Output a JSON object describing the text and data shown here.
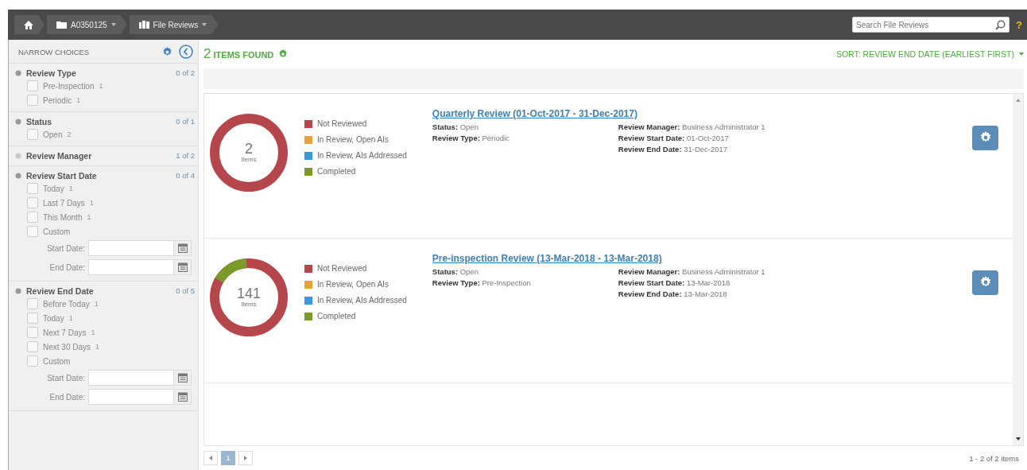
{
  "breadcrumbs": [
    {
      "kind": "home"
    },
    {
      "kind": "folder",
      "label": "A0350125"
    },
    {
      "kind": "reviews",
      "label": "File Reviews"
    }
  ],
  "search": {
    "placeholder": "Search File Reviews"
  },
  "help": "?",
  "sidebar": {
    "title": "NARROW CHOICES",
    "groups": [
      {
        "title": "Review Type",
        "count": "0 of 2",
        "expanded": true,
        "items": [
          {
            "label": "Pre-Inspection",
            "count": "1",
            "checked": false
          },
          {
            "label": "Periodic",
            "count": "1",
            "checked": false
          }
        ]
      },
      {
        "title": "Status",
        "count": "0 of 1",
        "expanded": true,
        "items": [
          {
            "label": "Open",
            "count": "2",
            "checked": false
          }
        ]
      },
      {
        "title": "Review Manager",
        "count": "1 of 2",
        "expanded": false
      },
      {
        "title": "Review Start Date",
        "count": "0 of 4",
        "expanded": true,
        "items": [
          {
            "label": "Today",
            "count": "1",
            "checked": false
          },
          {
            "label": "Last 7 Days",
            "count": "1",
            "checked": false
          },
          {
            "label": "This Month",
            "count": "1",
            "checked": false
          },
          {
            "label": "Custom",
            "checked": false
          }
        ],
        "date_fields": [
          {
            "label": "Start Date:"
          },
          {
            "label": "End Date:"
          }
        ]
      },
      {
        "title": "Review End Date",
        "count": "0 of 5",
        "expanded": true,
        "items": [
          {
            "label": "Before Today",
            "count": "1",
            "checked": false
          },
          {
            "label": "Today",
            "count": "1",
            "checked": false
          },
          {
            "label": "Next 7 Days",
            "count": "1",
            "checked": false
          },
          {
            "label": "Next 30 Days",
            "count": "1",
            "checked": false
          },
          {
            "label": "Custom",
            "checked": false
          }
        ],
        "date_fields": [
          {
            "label": "Start Date:"
          },
          {
            "label": "End Date:"
          }
        ]
      }
    ]
  },
  "results": {
    "count": "2",
    "label": "ITEMS FOUND",
    "sort": "SORT: REVIEW END DATE (EARLIEST FIRST)"
  },
  "records": [
    {
      "legend": [
        {
          "label": "Not Reviewed",
          "color": "#b5474c"
        },
        {
          "label": "In Review, Open AIs",
          "color": "#e8a03c"
        },
        {
          "label": "In Review, AIs Addressed",
          "color": "#3a9ad9"
        },
        {
          "label": "Completed",
          "color": "#7a9a2a"
        }
      ],
      "total": "2",
      "unit": "Items",
      "completed_segment": false,
      "title": "Quarterly Review (01-Oct-2017 - 31-Dec-2017)",
      "left": [
        {
          "label": "Status:",
          "value": "Open"
        },
        {
          "label": "Review Type:",
          "value": "Periodic"
        }
      ],
      "right": [
        {
          "label": "Review Manager:",
          "value": "Business Administrator 1"
        },
        {
          "label": "Review Start Date:",
          "value": "01-Oct-2017"
        },
        {
          "label": "Review End Date:",
          "value": "31-Dec-2017"
        }
      ]
    },
    {
      "legend": [
        {
          "label": "Not Reviewed",
          "color": "#b5474c"
        },
        {
          "label": "In Review, Open AIs",
          "color": "#e8a03c"
        },
        {
          "label": "In Review, AIs Addressed",
          "color": "#3a9ad9"
        },
        {
          "label": "Completed",
          "color": "#7a9a2a"
        }
      ],
      "total": "141",
      "unit": "Items",
      "completed_segment": true,
      "title": "Pre-inspection Review (13-Mar-2018 - 13-Mar-2018)",
      "left": [
        {
          "label": "Status:",
          "value": "Open"
        },
        {
          "label": "Review Type:",
          "value": "Pre-Inspection"
        }
      ],
      "right": [
        {
          "label": "Review Manager:",
          "value": "Business Administrator 1"
        },
        {
          "label": "Review Start Date:",
          "value": "13-Mar-2018"
        },
        {
          "label": "Review End Date:",
          "value": "13-Mar-2018"
        }
      ]
    }
  ],
  "pager": {
    "pages": [
      {
        "label": "1",
        "selected": true
      }
    ],
    "summary": "1 - 2 of 2 items"
  }
}
